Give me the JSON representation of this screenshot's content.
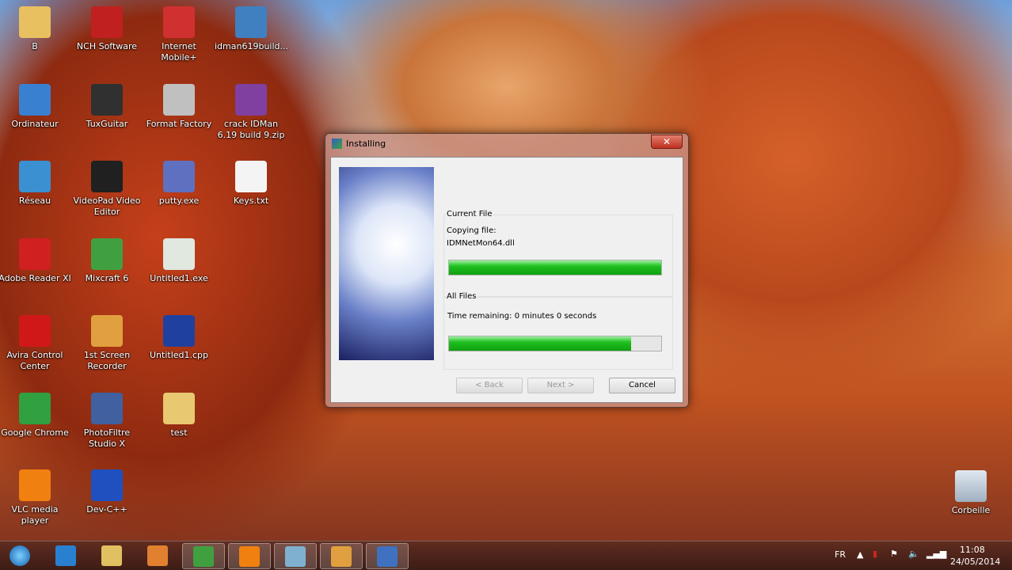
{
  "desktop_icons": [
    {
      "label": "B",
      "color": "#e8c060"
    },
    {
      "label": "NCH Software",
      "color": "#c02020"
    },
    {
      "label": "Internet Mobile+",
      "color": "#d03030"
    },
    {
      "label": "idman619build...",
      "color": "#4080c0"
    },
    {
      "label": "Ordinateur",
      "color": "#3a80d0"
    },
    {
      "label": "TuxGuitar",
      "color": "#303030"
    },
    {
      "label": "Format Factory",
      "color": "#c0c0c0"
    },
    {
      "label": "crack IDMan 6.19 build 9.zip",
      "color": "#8040a0"
    },
    {
      "label": "Réseau",
      "color": "#3a90d0"
    },
    {
      "label": "VideoPad Video Editor",
      "color": "#202020"
    },
    {
      "label": "putty.exe",
      "color": "#6070c0"
    },
    {
      "label": "Keys.txt",
      "color": "#f4f4f4"
    },
    {
      "label": "Adobe Reader XI",
      "color": "#d02020"
    },
    {
      "label": "Mixcraft 6",
      "color": "#40a040"
    },
    {
      "label": "Untitled1.exe",
      "color": "#e0e8e0"
    },
    {
      "label": "Avira Control Center",
      "color": "#d01818"
    },
    {
      "label": "1st Screen Recorder",
      "color": "#e0a040"
    },
    {
      "label": "Untitled1.cpp",
      "color": "#2040a0"
    },
    {
      "label": "Google Chrome",
      "color": "#30a040"
    },
    {
      "label": "PhotoFiltre Studio X",
      "color": "#4060a0"
    },
    {
      "label": "test",
      "color": "#e8c870"
    },
    {
      "label": "VLC media player",
      "color": "#f08010"
    },
    {
      "label": "Dev-C++",
      "color": "#2050c0"
    }
  ],
  "recycle_bin": {
    "label": "Corbeille"
  },
  "dialog": {
    "title": "Installing",
    "close": "✕",
    "current_file": {
      "heading": "Current File",
      "line1": "Copying file:",
      "line2": "IDMNetMon64.dll",
      "progress_percent": 100
    },
    "all_files": {
      "heading": "All Files",
      "time_remaining": "Time remaining: 0 minutes 0 seconds",
      "progress_percent": 86
    },
    "buttons": {
      "back": "< Back",
      "next": "Next >",
      "cancel": "Cancel"
    }
  },
  "taskbar": {
    "items": [
      {
        "name": "internet-explorer",
        "color": "#2a80d0"
      },
      {
        "name": "file-explorer",
        "color": "#e0c060"
      },
      {
        "name": "media-player",
        "color": "#e08030"
      },
      {
        "name": "google-chrome",
        "color": "#40a040"
      },
      {
        "name": "vlc",
        "color": "#f08010"
      },
      {
        "name": "notepad",
        "color": "#80b0d0"
      },
      {
        "name": "screen-recorder",
        "color": "#e0a040"
      },
      {
        "name": "installer",
        "color": "#4070c0"
      }
    ],
    "lang": "FR",
    "time": "11:08",
    "date": "24/05/2014"
  }
}
